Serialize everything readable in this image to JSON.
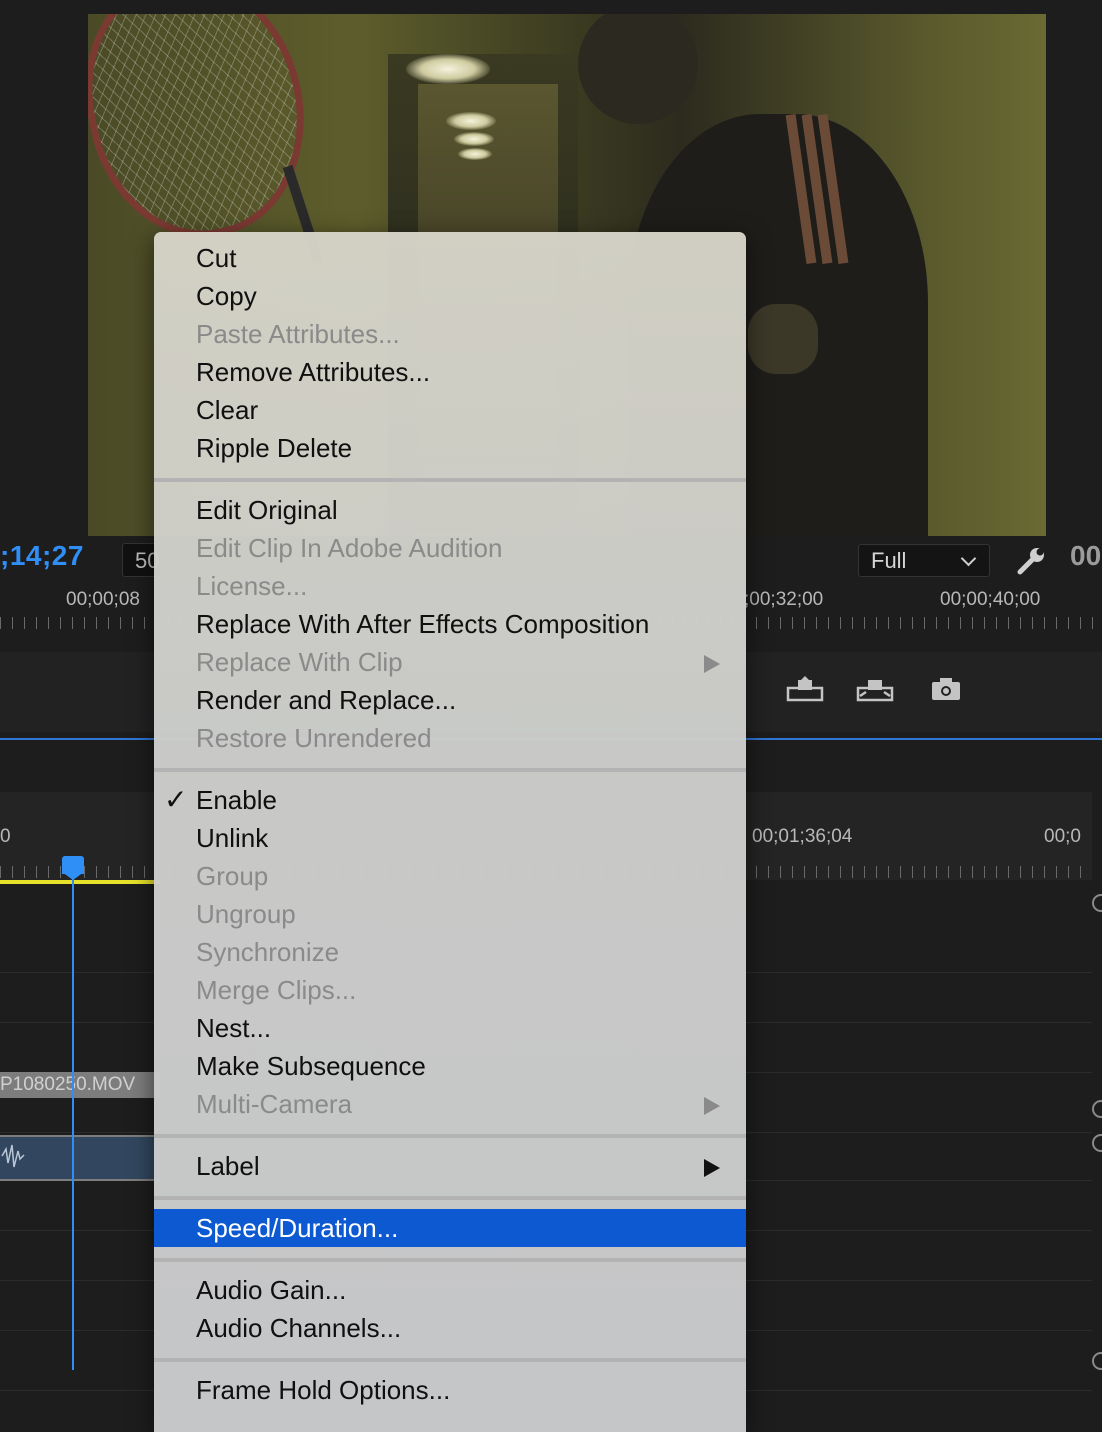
{
  "monitor": {
    "timecode_left": ";14;27",
    "zoom_value": "50",
    "resolution": "Full",
    "timecode_right": "00",
    "ruler_labels": [
      "00;00;08",
      ";00;32;00",
      "00;00;40;00"
    ]
  },
  "timeline": {
    "ruler_labels": [
      "0",
      "00;01;36;04",
      "00;0"
    ],
    "clip_name": "P1080250.MOV"
  },
  "context_menu": {
    "groups": [
      [
        {
          "label": "Cut",
          "enabled": true
        },
        {
          "label": "Copy",
          "enabled": true
        },
        {
          "label": "Paste Attributes...",
          "enabled": false
        },
        {
          "label": "Remove Attributes...",
          "enabled": true
        },
        {
          "label": "Clear",
          "enabled": true
        },
        {
          "label": "Ripple Delete",
          "enabled": true
        }
      ],
      [
        {
          "label": "Edit Original",
          "enabled": true
        },
        {
          "label": "Edit Clip In Adobe Audition",
          "enabled": false
        },
        {
          "label": "License...",
          "enabled": false
        },
        {
          "label": "Replace With After Effects Composition",
          "enabled": true
        },
        {
          "label": "Replace With Clip",
          "enabled": false,
          "submenu": true
        },
        {
          "label": "Render and Replace...",
          "enabled": true
        },
        {
          "label": "Restore Unrendered",
          "enabled": false
        }
      ],
      [
        {
          "label": "Enable",
          "enabled": true,
          "checked": true
        },
        {
          "label": "Unlink",
          "enabled": true
        },
        {
          "label": "Group",
          "enabled": false
        },
        {
          "label": "Ungroup",
          "enabled": false
        },
        {
          "label": "Synchronize",
          "enabled": false
        },
        {
          "label": "Merge Clips...",
          "enabled": false
        },
        {
          "label": "Nest...",
          "enabled": true
        },
        {
          "label": "Make Subsequence",
          "enabled": true
        },
        {
          "label": "Multi-Camera",
          "enabled": false,
          "submenu": true
        }
      ],
      [
        {
          "label": "Label",
          "enabled": true,
          "submenu": true
        }
      ],
      [
        {
          "label": "Speed/Duration...",
          "enabled": true,
          "highlighted": true
        }
      ],
      [
        {
          "label": "Audio Gain...",
          "enabled": true
        },
        {
          "label": "Audio Channels...",
          "enabled": true
        }
      ],
      [
        {
          "label": "Frame Hold Options...",
          "enabled": true
        }
      ]
    ],
    "check_glyph": "✓"
  },
  "colors": {
    "accent_blue": "#2f8ff7",
    "menu_highlight": "#0c59d2",
    "work_area": "#e6e22a",
    "audio_clip": "#32475f"
  }
}
